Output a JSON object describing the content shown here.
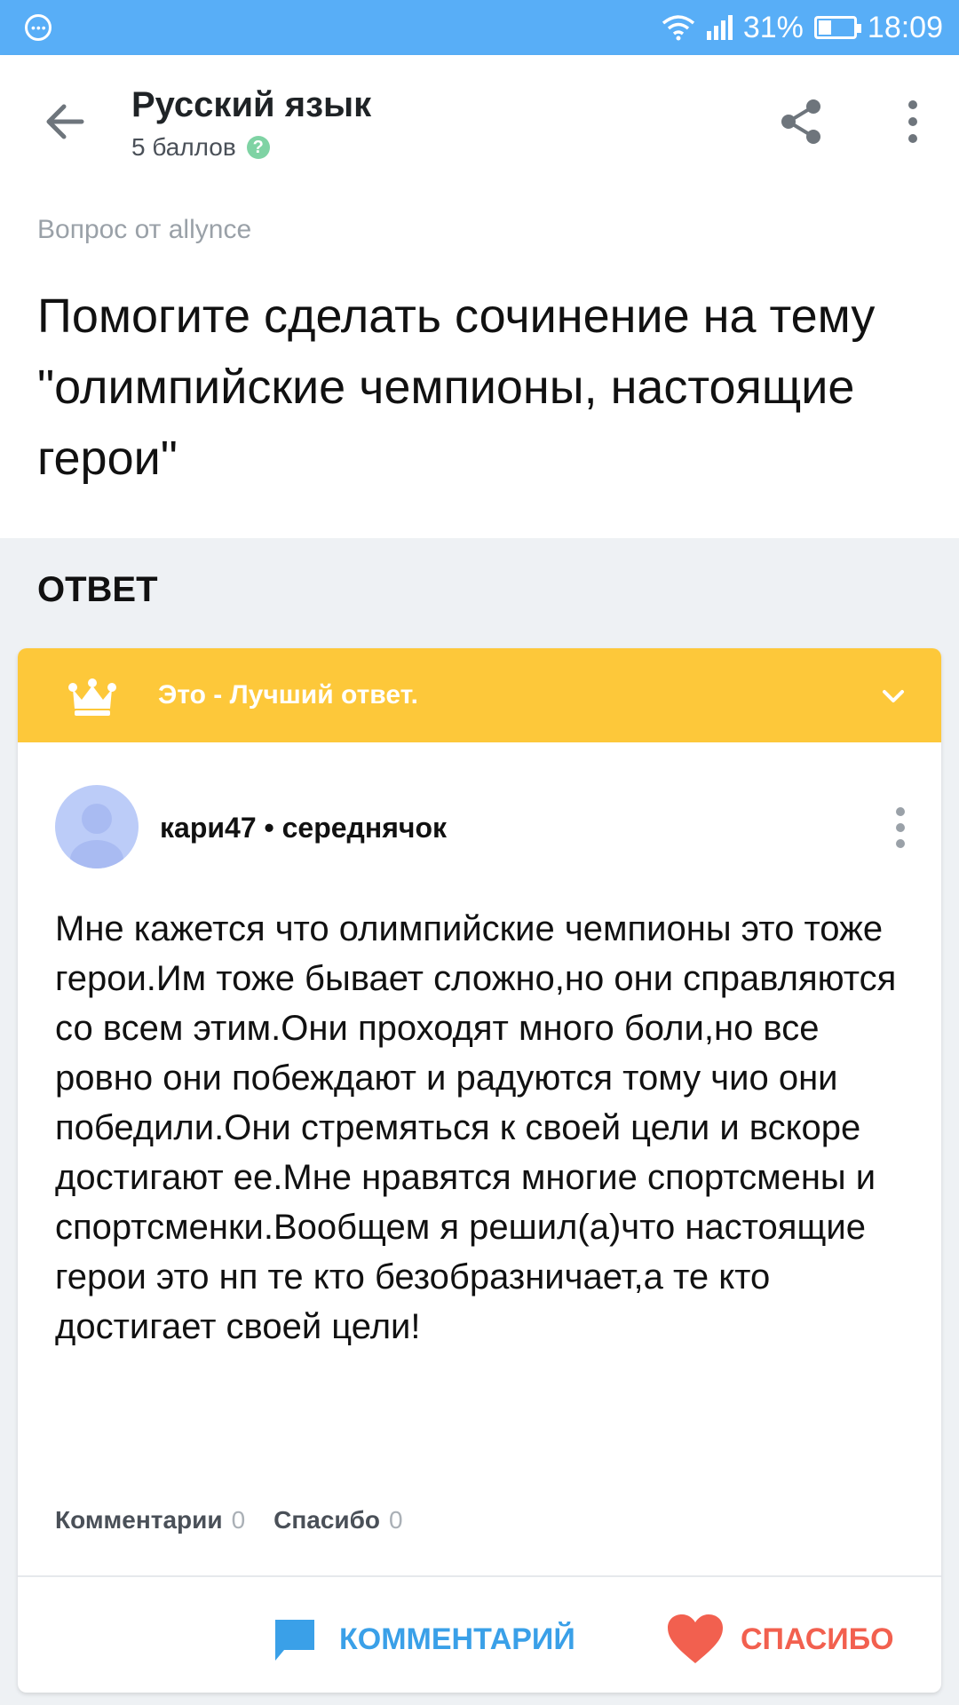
{
  "status_bar": {
    "battery": "31%",
    "time": "18:09"
  },
  "app_bar": {
    "subject": "Русский язык",
    "points": "5 баллов"
  },
  "question": {
    "asked_by": "Вопрос от allynce",
    "text": "Помогите сделать сочинение на тему \"олимпийские чемпионы, настоящие герои\""
  },
  "answer_section": {
    "heading": "ОТВЕТ"
  },
  "answer": {
    "best_label": "Это - Лучший ответ.",
    "author": "кари47 • середнячок",
    "text": "Мне кажется что олимпийские чемпионы это тоже герои.Им тоже бывает сложно,но они справляются со всем этим.Они проходят много боли,но все ровно они побеждают и радуются тому чио они победили.Они стремяться к своей цели и вскоре достигают ее.Мне нравятся многие спортсмены и спортсменки.Вообщем я решил(а)что настоящие герои это нп те кто безобразничает,а те кто достигает своей цели!",
    "comments_label": "Комментарии",
    "comments_count": "0",
    "thanks_label": "Спасибо",
    "thanks_count": "0",
    "comment_button": "КОММЕНТАРИЙ",
    "thanks_button": "СПАСИБО"
  },
  "colors": {
    "status_bar": "#58aef7",
    "best_banner": "#fdc83a",
    "comment_blue": "#3aa0e8",
    "thanks_red": "#f2604f"
  }
}
